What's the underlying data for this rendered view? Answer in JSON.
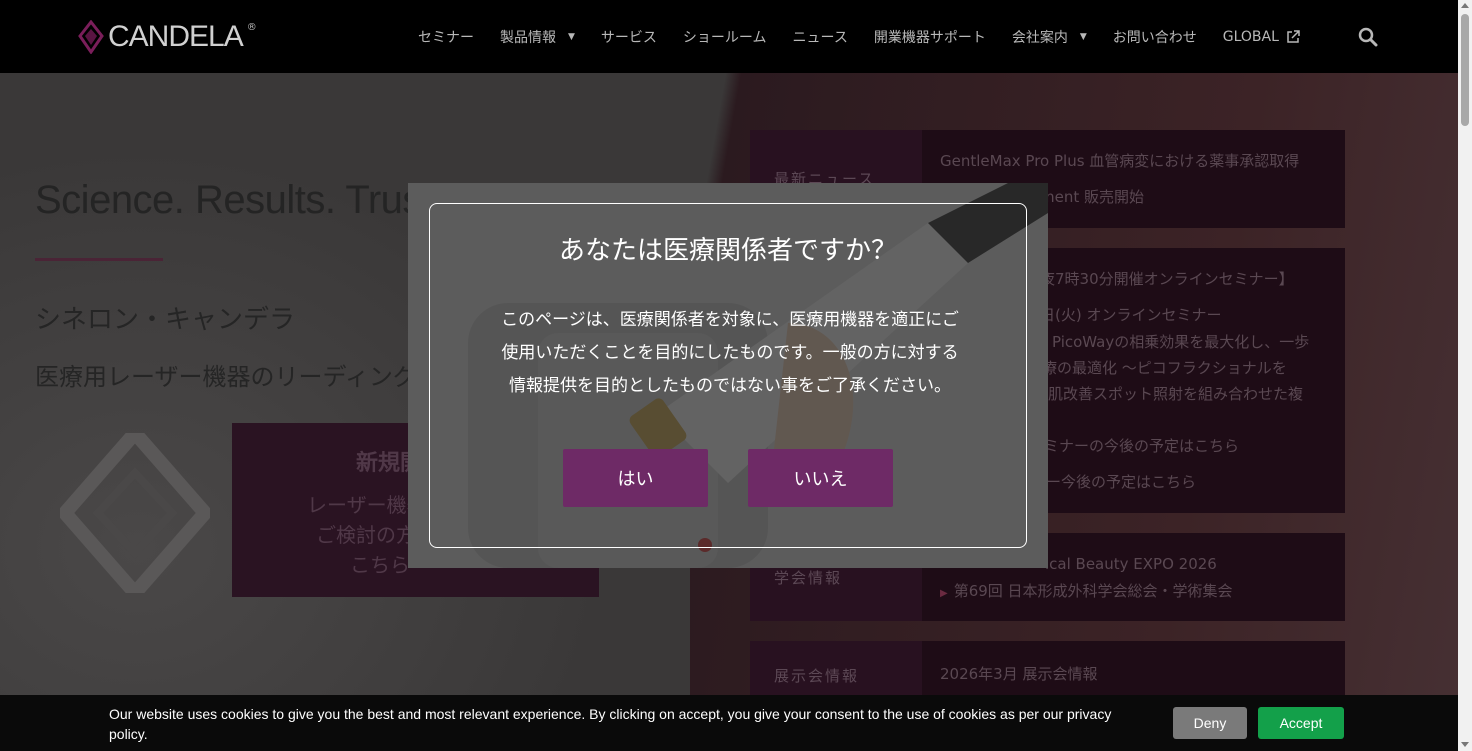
{
  "header": {
    "logo_text": "CANDELA",
    "logo_reg": "®",
    "nav": [
      {
        "label": "セミナー",
        "dropdown": false
      },
      {
        "label": "製品情報",
        "dropdown": true
      },
      {
        "label": "サービス",
        "dropdown": false
      },
      {
        "label": "ショールーム",
        "dropdown": false
      },
      {
        "label": "ニュース",
        "dropdown": false
      },
      {
        "label": "開業機器サポート",
        "dropdown": false
      },
      {
        "label": "会社案内",
        "dropdown": true
      },
      {
        "label": "お問い合わせ",
        "dropdown": false
      },
      {
        "label": "GLOBAL",
        "external": true
      }
    ],
    "caret_glyph": "▼"
  },
  "hero": {
    "title": "Science. Results. Trust.",
    "sub1": "シネロン・キャンデラ",
    "sub2": "医療用レーザー機器のリーディングカンパニー",
    "cta_title": "新規開業",
    "cta_line1": "レーザー機器の導入を",
    "cta_line2": "ご検討の方は",
    "cta_line3": "こちら"
  },
  "panels": {
    "news_label": "最新ニュース",
    "news_1": "GentleMax Pro Plus 血管病変における薬事承認取得",
    "news_2": "ment 販売開始",
    "seminar_1": "夜7時30分開催オンラインセミナー】",
    "seminar_2": "日(火) オンラインセミナー",
    "seminar_3": "PicoWayの相乗効果を最大化し、一歩",
    "seminar_4": "療の最適化 ～ピコフラクショナルを",
    "seminar_5": "肌改善スポット照射を組み合わせた複",
    "seminar_6": "ミナーの今後の予定はこちら",
    "seminar_7": "ー今後の予定はこちら",
    "conf_label": "学会情報",
    "conf_1": "ical Beauty EXPO 2026",
    "conf_2": "第69回 日本形成外科学会総会・学術集会",
    "expo_label": "展示会情報",
    "expo_1": "2026年3月 展示会情報"
  },
  "modal": {
    "title": "あなたは医療関係者ですか？",
    "line1": "このページは、医療関係者を対象に、医療用機器を適正にご",
    "line2": "使用いただくことを目的にしたものです。一般の方に対する",
    "line3": "情報提供を目的としたものではない事をご了承ください。",
    "yes_label": "はい",
    "no_label": "いいえ"
  },
  "cookie": {
    "text": "Our website uses cookies to give you the best and most relevant experience. By clicking on accept, you give your consent to the use of cookies as per our privacy policy.",
    "deny_label": "Deny",
    "accept_label": "Accept"
  },
  "colors": {
    "brand_purple": "#6e2a66",
    "accept_green": "#13a04a",
    "deny_gray": "#7a7a7a"
  }
}
